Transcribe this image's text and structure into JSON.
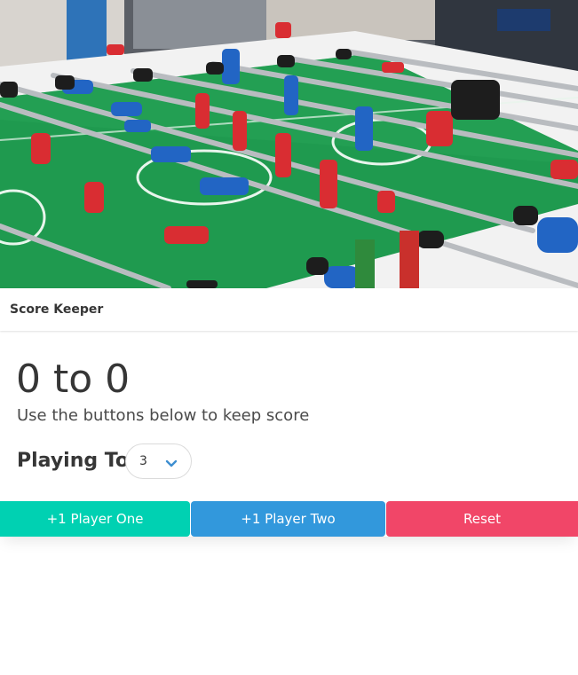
{
  "header": {
    "title": "Score Keeper"
  },
  "scoreboard": {
    "player_one_score": "0",
    "separator": "to",
    "player_two_score": "0",
    "subtitle": "Use the buttons below to keep score"
  },
  "playing_to": {
    "label": "Playing To",
    "selected": "3"
  },
  "buttons": {
    "player_one": "+1 Player One",
    "player_two": "+1 Player Two",
    "reset": "Reset"
  },
  "colors": {
    "player_one": "#00d1b2",
    "player_two": "#3298dc",
    "reset": "#f14668",
    "text": "#363636"
  },
  "icons": {
    "select_arrow": "chevron-down-icon"
  }
}
